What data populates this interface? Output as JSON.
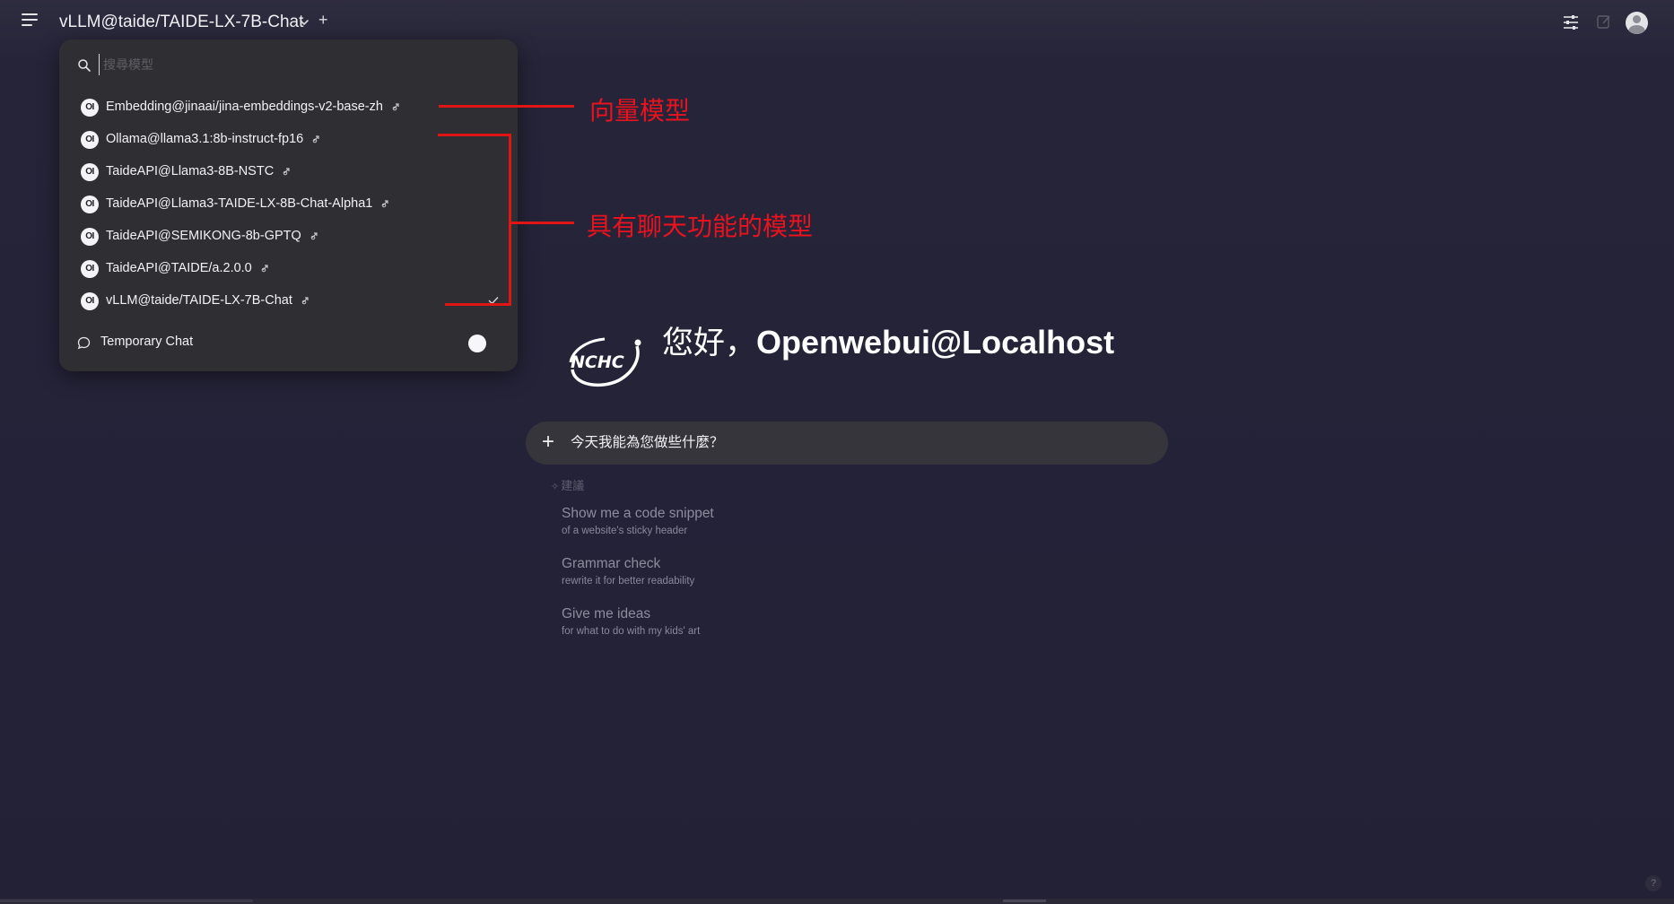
{
  "header": {
    "current_model": "vLLM@taide/TAIDE-LX-7B-Chat",
    "new_chat_symbol": "+"
  },
  "model_selector": {
    "search_placeholder": "搜尋模型",
    "models": [
      {
        "label": "Embedding@jinaai/jina-embeddings-v2-base-zh",
        "badge": "OI"
      },
      {
        "label": "Ollama@llama3.1:8b-instruct-fp16",
        "badge": "OI"
      },
      {
        "label": "TaideAPI@Llama3-8B-NSTC",
        "badge": "OI"
      },
      {
        "label": "TaideAPI@Llama3-TAIDE-LX-8B-Chat-Alpha1",
        "badge": "OI"
      },
      {
        "label": "TaideAPI@SEMIKONG-8b-GPTQ",
        "badge": "OI"
      },
      {
        "label": "TaideAPI@TAIDE/a.2.0.0",
        "badge": "OI"
      },
      {
        "label": "vLLM@taide/TAIDE-LX-7B-Chat",
        "badge": "OI",
        "selected": true
      }
    ],
    "temporary_chat_label": "Temporary Chat"
  },
  "annotations": {
    "embedding_label": "向量模型",
    "chat_models_label": "具有聊天功能的模型",
    "color": "#e01515"
  },
  "greeting": {
    "prefix": "您好，",
    "user": "Openwebui@Localhost",
    "logo_text": "NCHC"
  },
  "chat_input": {
    "placeholder": "今天我能為您做些什麼？",
    "plus_symbol": "+"
  },
  "suggestions": {
    "header": "建議",
    "items": [
      {
        "title": "Show me a code snippet",
        "subtitle": "of a website's sticky header"
      },
      {
        "title": "Grammar check",
        "subtitle": "rewrite it for better readability"
      },
      {
        "title": "Give me ideas",
        "subtitle": "for what to do with my kids' art"
      }
    ]
  },
  "help_label": "?",
  "icons": [
    "menu-icon",
    "chevron-down-icon",
    "sliders-icon",
    "edit-icon",
    "user-avatar-icon",
    "search-icon",
    "link-icon",
    "check-icon",
    "chat-bubble-icon",
    "sparkle-icon",
    "help-icon"
  ]
}
